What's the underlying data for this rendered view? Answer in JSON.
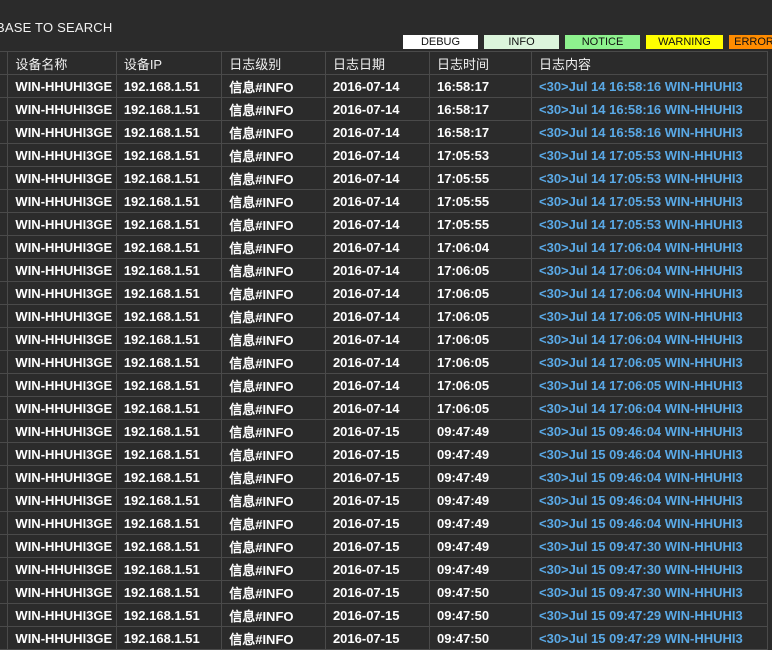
{
  "header": {
    "title": "BASE TO SEARCH"
  },
  "legend": [
    {
      "label": "DEBUG"
    },
    {
      "label": "INFO"
    },
    {
      "label": "NOTICE"
    },
    {
      "label": "WARNING"
    },
    {
      "label": "ERROR"
    }
  ],
  "colors": {
    "background": "#2b2b2b",
    "message_text": "#5aa9e6",
    "debug": "#ffffff",
    "info": "#dcf5dc",
    "notice": "#8ef28e",
    "warning": "#ffff00",
    "error": "#ff8c00"
  },
  "table": {
    "columns": [
      "设备名称",
      "设备IP",
      "日志级别",
      "日志日期",
      "日志时间",
      "日志内容"
    ],
    "rows": [
      {
        "device": "WIN-HHUHI3GE",
        "ip": "192.168.1.51",
        "level": "信息#INFO",
        "date": "2016-07-14",
        "time": "16:58:17",
        "msg": "<30>Jul 14 16:58:16 WIN-HHUHI3"
      },
      {
        "device": "WIN-HHUHI3GE",
        "ip": "192.168.1.51",
        "level": "信息#INFO",
        "date": "2016-07-14",
        "time": "16:58:17",
        "msg": "<30>Jul 14 16:58:16 WIN-HHUHI3"
      },
      {
        "device": "WIN-HHUHI3GE",
        "ip": "192.168.1.51",
        "level": "信息#INFO",
        "date": "2016-07-14",
        "time": "16:58:17",
        "msg": "<30>Jul 14 16:58:16 WIN-HHUHI3"
      },
      {
        "device": "WIN-HHUHI3GE",
        "ip": "192.168.1.51",
        "level": "信息#INFO",
        "date": "2016-07-14",
        "time": "17:05:53",
        "msg": "<30>Jul 14 17:05:53 WIN-HHUHI3"
      },
      {
        "device": "WIN-HHUHI3GE",
        "ip": "192.168.1.51",
        "level": "信息#INFO",
        "date": "2016-07-14",
        "time": "17:05:55",
        "msg": "<30>Jul 14 17:05:53 WIN-HHUHI3"
      },
      {
        "device": "WIN-HHUHI3GE",
        "ip": "192.168.1.51",
        "level": "信息#INFO",
        "date": "2016-07-14",
        "time": "17:05:55",
        "msg": "<30>Jul 14 17:05:53 WIN-HHUHI3"
      },
      {
        "device": "WIN-HHUHI3GE",
        "ip": "192.168.1.51",
        "level": "信息#INFO",
        "date": "2016-07-14",
        "time": "17:05:55",
        "msg": "<30>Jul 14 17:05:53 WIN-HHUHI3"
      },
      {
        "device": "WIN-HHUHI3GE",
        "ip": "192.168.1.51",
        "level": "信息#INFO",
        "date": "2016-07-14",
        "time": "17:06:04",
        "msg": "<30>Jul 14 17:06:04 WIN-HHUHI3"
      },
      {
        "device": "WIN-HHUHI3GE",
        "ip": "192.168.1.51",
        "level": "信息#INFO",
        "date": "2016-07-14",
        "time": "17:06:05",
        "msg": "<30>Jul 14 17:06:04 WIN-HHUHI3"
      },
      {
        "device": "WIN-HHUHI3GE",
        "ip": "192.168.1.51",
        "level": "信息#INFO",
        "date": "2016-07-14",
        "time": "17:06:05",
        "msg": "<30>Jul 14 17:06:04 WIN-HHUHI3"
      },
      {
        "device": "WIN-HHUHI3GE",
        "ip": "192.168.1.51",
        "level": "信息#INFO",
        "date": "2016-07-14",
        "time": "17:06:05",
        "msg": "<30>Jul 14 17:06:05 WIN-HHUHI3"
      },
      {
        "device": "WIN-HHUHI3GE",
        "ip": "192.168.1.51",
        "level": "信息#INFO",
        "date": "2016-07-14",
        "time": "17:06:05",
        "msg": "<30>Jul 14 17:06:04 WIN-HHUHI3"
      },
      {
        "device": "WIN-HHUHI3GE",
        "ip": "192.168.1.51",
        "level": "信息#INFO",
        "date": "2016-07-14",
        "time": "17:06:05",
        "msg": "<30>Jul 14 17:06:05 WIN-HHUHI3"
      },
      {
        "device": "WIN-HHUHI3GE",
        "ip": "192.168.1.51",
        "level": "信息#INFO",
        "date": "2016-07-14",
        "time": "17:06:05",
        "msg": "<30>Jul 14 17:06:05 WIN-HHUHI3"
      },
      {
        "device": "WIN-HHUHI3GE",
        "ip": "192.168.1.51",
        "level": "信息#INFO",
        "date": "2016-07-14",
        "time": "17:06:05",
        "msg": "<30>Jul 14 17:06:04 WIN-HHUHI3"
      },
      {
        "device": "WIN-HHUHI3GE",
        "ip": "192.168.1.51",
        "level": "信息#INFO",
        "date": "2016-07-15",
        "time": "09:47:49",
        "msg": "<30>Jul 15 09:46:04 WIN-HHUHI3"
      },
      {
        "device": "WIN-HHUHI3GE",
        "ip": "192.168.1.51",
        "level": "信息#INFO",
        "date": "2016-07-15",
        "time": "09:47:49",
        "msg": "<30>Jul 15 09:46:04 WIN-HHUHI3"
      },
      {
        "device": "WIN-HHUHI3GE",
        "ip": "192.168.1.51",
        "level": "信息#INFO",
        "date": "2016-07-15",
        "time": "09:47:49",
        "msg": "<30>Jul 15 09:46:04 WIN-HHUHI3"
      },
      {
        "device": "WIN-HHUHI3GE",
        "ip": "192.168.1.51",
        "level": "信息#INFO",
        "date": "2016-07-15",
        "time": "09:47:49",
        "msg": "<30>Jul 15 09:46:04 WIN-HHUHI3"
      },
      {
        "device": "WIN-HHUHI3GE",
        "ip": "192.168.1.51",
        "level": "信息#INFO",
        "date": "2016-07-15",
        "time": "09:47:49",
        "msg": "<30>Jul 15 09:46:04 WIN-HHUHI3"
      },
      {
        "device": "WIN-HHUHI3GE",
        "ip": "192.168.1.51",
        "level": "信息#INFO",
        "date": "2016-07-15",
        "time": "09:47:49",
        "msg": "<30>Jul 15 09:47:30 WIN-HHUHI3"
      },
      {
        "device": "WIN-HHUHI3GE",
        "ip": "192.168.1.51",
        "level": "信息#INFO",
        "date": "2016-07-15",
        "time": "09:47:49",
        "msg": "<30>Jul 15 09:47:30 WIN-HHUHI3"
      },
      {
        "device": "WIN-HHUHI3GE",
        "ip": "192.168.1.51",
        "level": "信息#INFO",
        "date": "2016-07-15",
        "time": "09:47:50",
        "msg": "<30>Jul 15 09:47:30 WIN-HHUHI3"
      },
      {
        "device": "WIN-HHUHI3GE",
        "ip": "192.168.1.51",
        "level": "信息#INFO",
        "date": "2016-07-15",
        "time": "09:47:50",
        "msg": "<30>Jul 15 09:47:29 WIN-HHUHI3"
      },
      {
        "device": "WIN-HHUHI3GE",
        "ip": "192.168.1.51",
        "level": "信息#INFO",
        "date": "2016-07-15",
        "time": "09:47:50",
        "msg": "<30>Jul 15 09:47:29 WIN-HHUHI3"
      }
    ]
  }
}
